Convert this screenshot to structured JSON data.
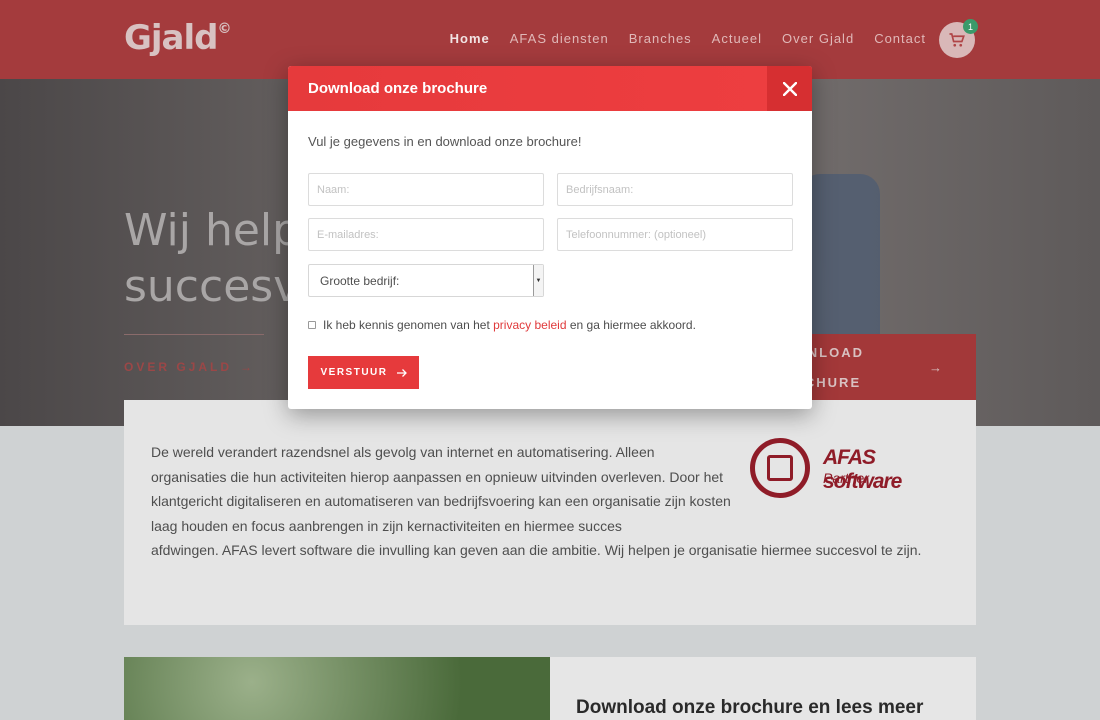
{
  "header": {
    "logo": "Gjald",
    "logo_mark": "©",
    "nav": [
      "Home",
      "AFAS diensten",
      "Branches",
      "Actueel",
      "Over Gjald",
      "Contact"
    ],
    "cart_count": "1"
  },
  "hero": {
    "title": "Wij helpen jouw organisatie succesvoller te zijn!",
    "link_label": "OVER GJALD",
    "cta_label": "DOWNLOAD ONZE BROCHURE"
  },
  "intro": {
    "text_part1": "De wereld verandert razendsnel als gevolg van internet en automatisering. Alleen organisaties die hun activiteiten hierop aanpassen en opnieuw uitvinden overleven. Door het klantgericht digitaliseren en automatiseren van bedrijfsvoering kan een organisatie zijn kosten laag houden en focus aanbrengen in zijn kernactiviteiten en hiermee succes",
    "text_part2": "afdwingen.  AFAS levert software die invulling kan geven aan die ambitie. Wij helpen je organisatie hiermee succesvol te zijn.",
    "partner_name": "AFAS software",
    "partner_label": "Partner"
  },
  "download_section": {
    "title": "Download onze brochure en lees meer"
  },
  "modal": {
    "title": "Download onze brochure",
    "intro": "Vul je gegevens in en download onze brochure!",
    "fields": {
      "naam": "Naam:",
      "bedrijfsnaam": "Bedrijfsnaam:",
      "email": "E-mailadres:",
      "telefoon": "Telefoonnummer: (optioneel)"
    },
    "select_value": "Grootte bedrijf:",
    "consent_before": "Ik heb kennis genomen van het ",
    "consent_link": "privacy beleid",
    "consent_after": " en ga hiermee akkoord.",
    "submit_label": "VERSTUUR"
  },
  "colors": {
    "accent": "#e63a3c",
    "afas": "#8f1c28"
  }
}
